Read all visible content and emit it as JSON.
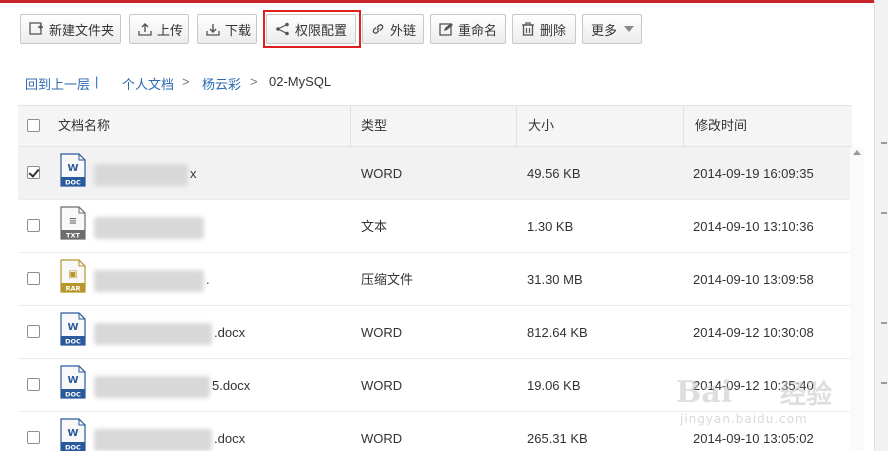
{
  "toolbar": {
    "buttons": [
      {
        "label": "新建文件夹",
        "icon": "new-folder-icon"
      },
      {
        "label": "上传",
        "icon": "upload-icon"
      },
      {
        "label": "下载",
        "icon": "download-icon"
      },
      {
        "label": "权限配置",
        "icon": "share-icon"
      },
      {
        "label": "外链",
        "icon": "link-icon"
      },
      {
        "label": "重命名",
        "icon": "rename-icon"
      },
      {
        "label": "删除",
        "icon": "trash-icon"
      },
      {
        "label": "更多",
        "icon": "caret-down-icon"
      }
    ]
  },
  "breadcrumb": {
    "back": "回到上一层",
    "back_sep": "|",
    "items": [
      "个人文档",
      "杨云彩"
    ],
    "sep": ">",
    "current": "02-MySQL"
  },
  "table": {
    "columns": [
      "文档名称",
      "类型",
      "大小",
      "修改时间"
    ],
    "rows": [
      {
        "icon_label": "W",
        "icon_tag": "DOC",
        "name_suffix": "x",
        "type": "WORD",
        "size": "49.56 KB",
        "modified": "2014-09-19 16:09:35",
        "checked": true
      },
      {
        "icon_label": "≡",
        "icon_tag": "TXT",
        "name_suffix": "",
        "type": "文本",
        "size": "1.30 KB",
        "modified": "2014-09-10 13:10:36",
        "checked": false
      },
      {
        "icon_label": "▣",
        "icon_tag": "RAR",
        "name_suffix": ".",
        "type": "压缩文件",
        "size": "31.30 MB",
        "modified": "2014-09-10 13:09:58",
        "checked": false
      },
      {
        "icon_label": "W",
        "icon_tag": "DOC",
        "name_suffix": ".docx",
        "type": "WORD",
        "size": "812.64 KB",
        "modified": "2014-09-12 10:30:08",
        "checked": false
      },
      {
        "icon_label": "W",
        "icon_tag": "DOC",
        "name_suffix": "5.docx",
        "type": "WORD",
        "size": "19.06 KB",
        "modified": "2014-09-12 10:35:40",
        "checked": false
      },
      {
        "icon_label": "W",
        "icon_tag": "DOC",
        "name_suffix": ".docx",
        "type": "WORD",
        "size": "265.31 KB",
        "modified": "2014-09-10 13:05:02",
        "checked": false
      }
    ]
  },
  "colors": {
    "accent_red": "#c9242b",
    "highlight_red": "#e02020",
    "link_blue": "#2c6bb3",
    "doc_blue": "#2a5a9c",
    "txt_gray": "#6d6d6d",
    "rar_gold": "#b8962e"
  },
  "watermark": {
    "brand": "Bai",
    "cn": "经验",
    "url": "jingyan.baidu.com"
  }
}
